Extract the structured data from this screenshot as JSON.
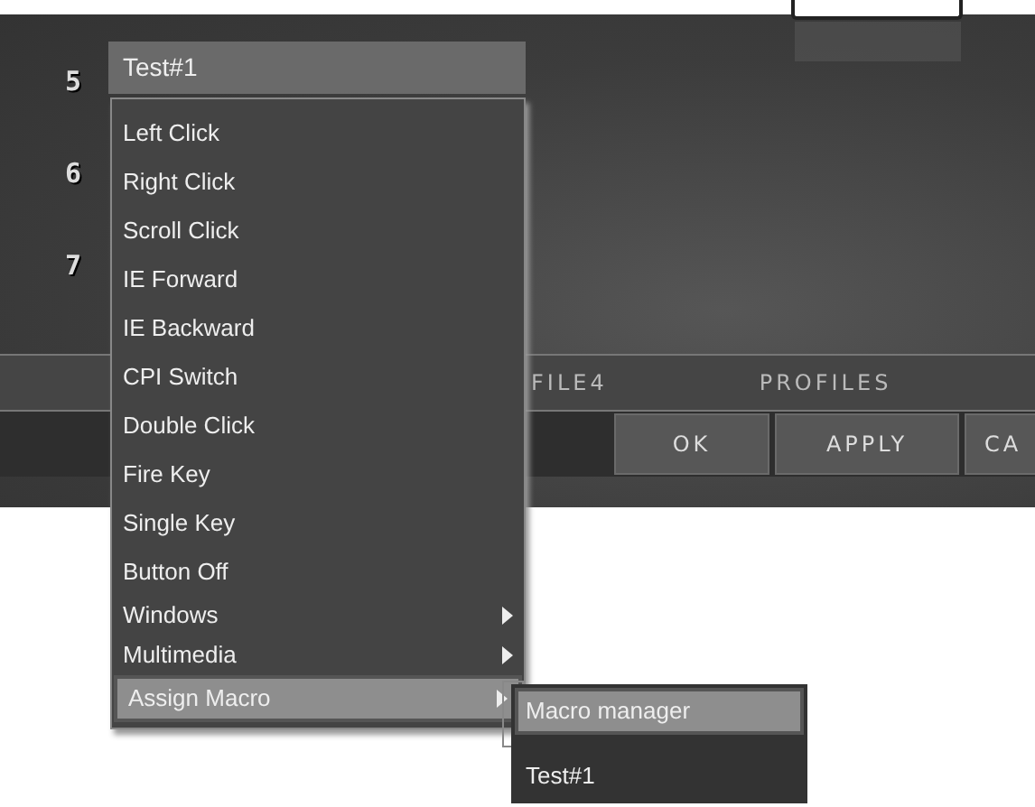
{
  "rows": [
    {
      "number": "5"
    },
    {
      "number": "6"
    },
    {
      "number": "7"
    }
  ],
  "dropdown": {
    "value": "Test#1"
  },
  "profile_tabs": [
    "FILE4",
    "PROFILES"
  ],
  "buttons": [
    "OK",
    "APPLY",
    "CA"
  ],
  "menu": {
    "items": [
      {
        "label": "Left Click",
        "has_submenu": false,
        "selected": false
      },
      {
        "label": "Right Click",
        "has_submenu": false,
        "selected": false
      },
      {
        "label": "Scroll Click",
        "has_submenu": false,
        "selected": false
      },
      {
        "label": "IE Forward",
        "has_submenu": false,
        "selected": false
      },
      {
        "label": "IE Backward",
        "has_submenu": false,
        "selected": false
      },
      {
        "label": "CPI Switch",
        "has_submenu": false,
        "selected": false
      },
      {
        "label": "Double Click",
        "has_submenu": false,
        "selected": false
      },
      {
        "label": "Fire Key",
        "has_submenu": false,
        "selected": false
      },
      {
        "label": "Single Key",
        "has_submenu": false,
        "selected": false
      },
      {
        "label": "Button Off",
        "has_submenu": false,
        "selected": false
      },
      {
        "label": "Windows",
        "has_submenu": true,
        "selected": false
      },
      {
        "label": "Multimedia",
        "has_submenu": true,
        "selected": false
      },
      {
        "label": "Assign Macro",
        "has_submenu": true,
        "selected": true
      }
    ]
  },
  "submenu": {
    "items": [
      {
        "label": "Macro manager",
        "selected": true
      },
      {
        "label": "Test#1",
        "selected": false
      }
    ]
  }
}
